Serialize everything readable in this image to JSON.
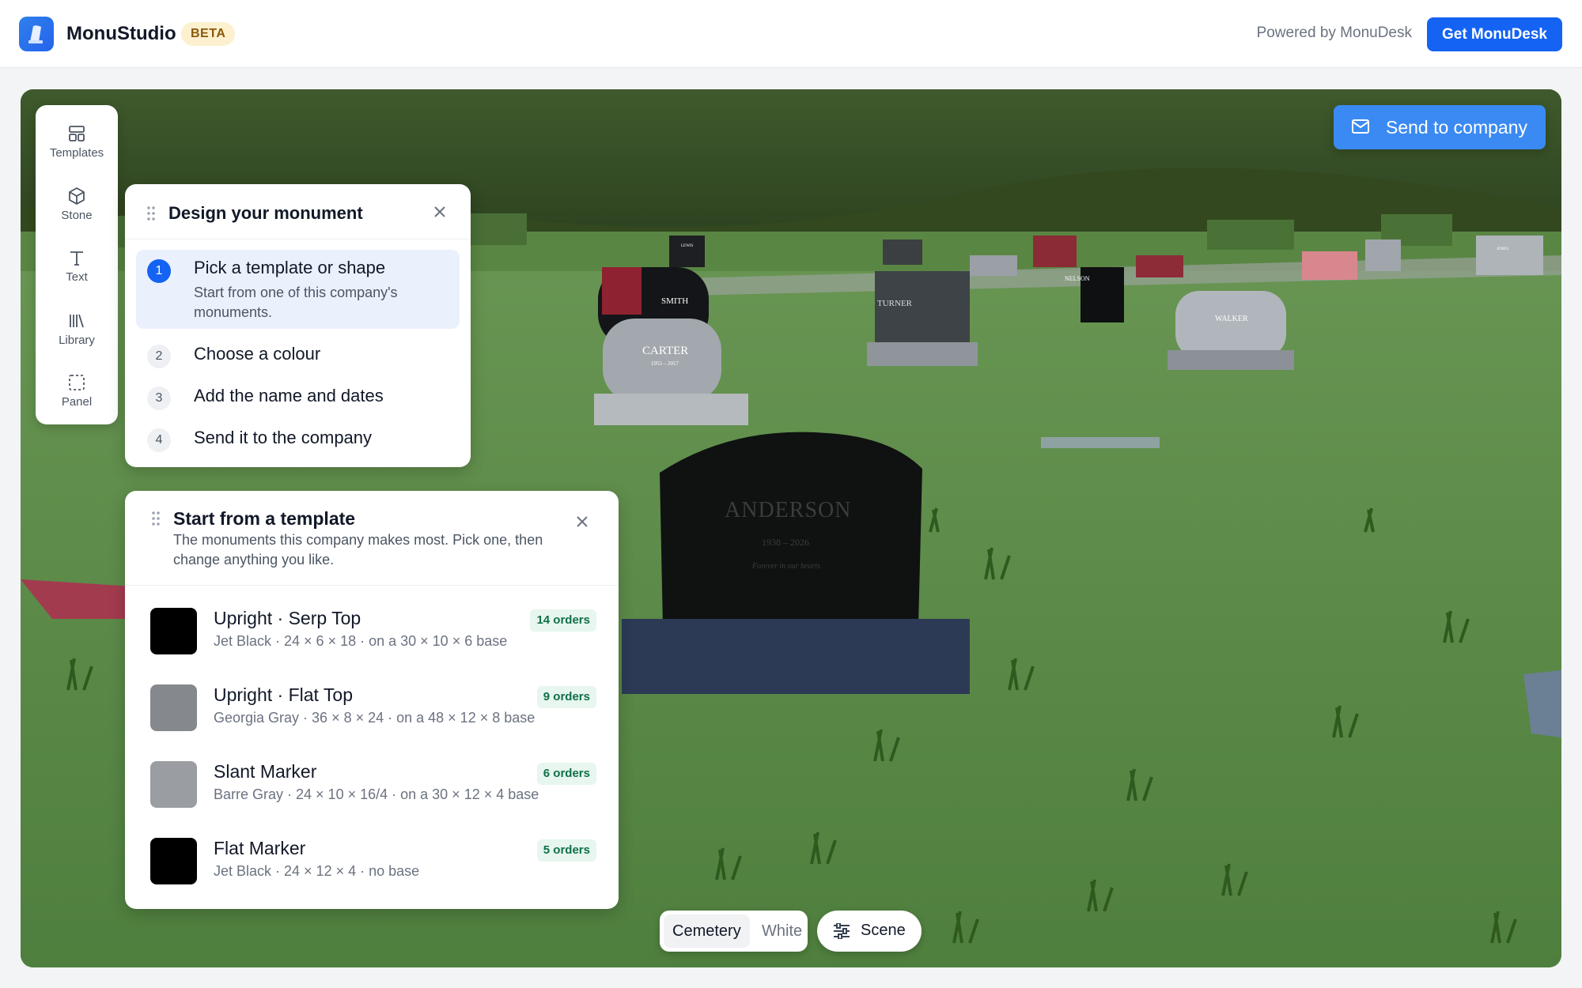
{
  "header": {
    "app_name": "MonuStudio",
    "badge": "BETA",
    "powered_by": "Powered by MonuDesk",
    "cta": "Get MonuDesk"
  },
  "rail": {
    "items": [
      {
        "label": "Templates",
        "icon": "layout-icon"
      },
      {
        "label": "Stone",
        "icon": "cube-icon"
      },
      {
        "label": "Text",
        "icon": "text-icon"
      },
      {
        "label": "Library",
        "icon": "library-icon"
      },
      {
        "label": "Panel",
        "icon": "dashed-square-icon"
      }
    ]
  },
  "design_panel": {
    "title": "Design your monument",
    "steps": [
      {
        "num": "1",
        "title": "Pick a template or shape",
        "subtitle": "Start from one of this company's monuments.",
        "active": true
      },
      {
        "num": "2",
        "title": "Choose a colour"
      },
      {
        "num": "3",
        "title": "Add the name and dates"
      },
      {
        "num": "4",
        "title": "Send it to the company"
      }
    ]
  },
  "template_panel": {
    "title": "Start from a template",
    "subtitle": "The monuments this company makes most. Pick one, then change anything you like.",
    "rows": [
      {
        "title": "Upright · Serp Top",
        "detail": "Jet Black · 24 × 6 × 18 · on a 30 × 10 × 6 base",
        "orders": "14 orders",
        "color": "#000000"
      },
      {
        "title": "Upright · Flat Top",
        "detail": "Georgia Gray · 36 × 8 × 24 · on a 48 × 12 × 8 base",
        "orders": "9 orders",
        "color": "#85888c"
      },
      {
        "title": "Slant Marker",
        "detail": "Barre Gray · 24 × 10 × 16/4 · on a 30 × 12 × 4 base",
        "orders": "6 orders",
        "color": "#9a9da2"
      },
      {
        "title": "Flat Marker",
        "detail": "Jet Black · 24 × 12 × 4 · no base",
        "orders": "5 orders",
        "color": "#000000"
      }
    ]
  },
  "scene": {
    "send_button": "Send to company",
    "background_options": [
      "Cemetery",
      "White"
    ],
    "selected_background": "Cemetery",
    "scene_button": "Scene",
    "headstones": [
      {
        "name": "ANDERSON",
        "dates": "1938 – 2026",
        "epitaph": "Forever in our hearts"
      },
      {
        "name": "CARTER",
        "dates": "1955 – 2017"
      },
      {
        "name": "SMITH"
      },
      {
        "name": "TURNER"
      },
      {
        "name": "NELSON"
      },
      {
        "name": "WALKER"
      },
      {
        "name": "LEWIS"
      },
      {
        "name": "JONES"
      }
    ]
  }
}
